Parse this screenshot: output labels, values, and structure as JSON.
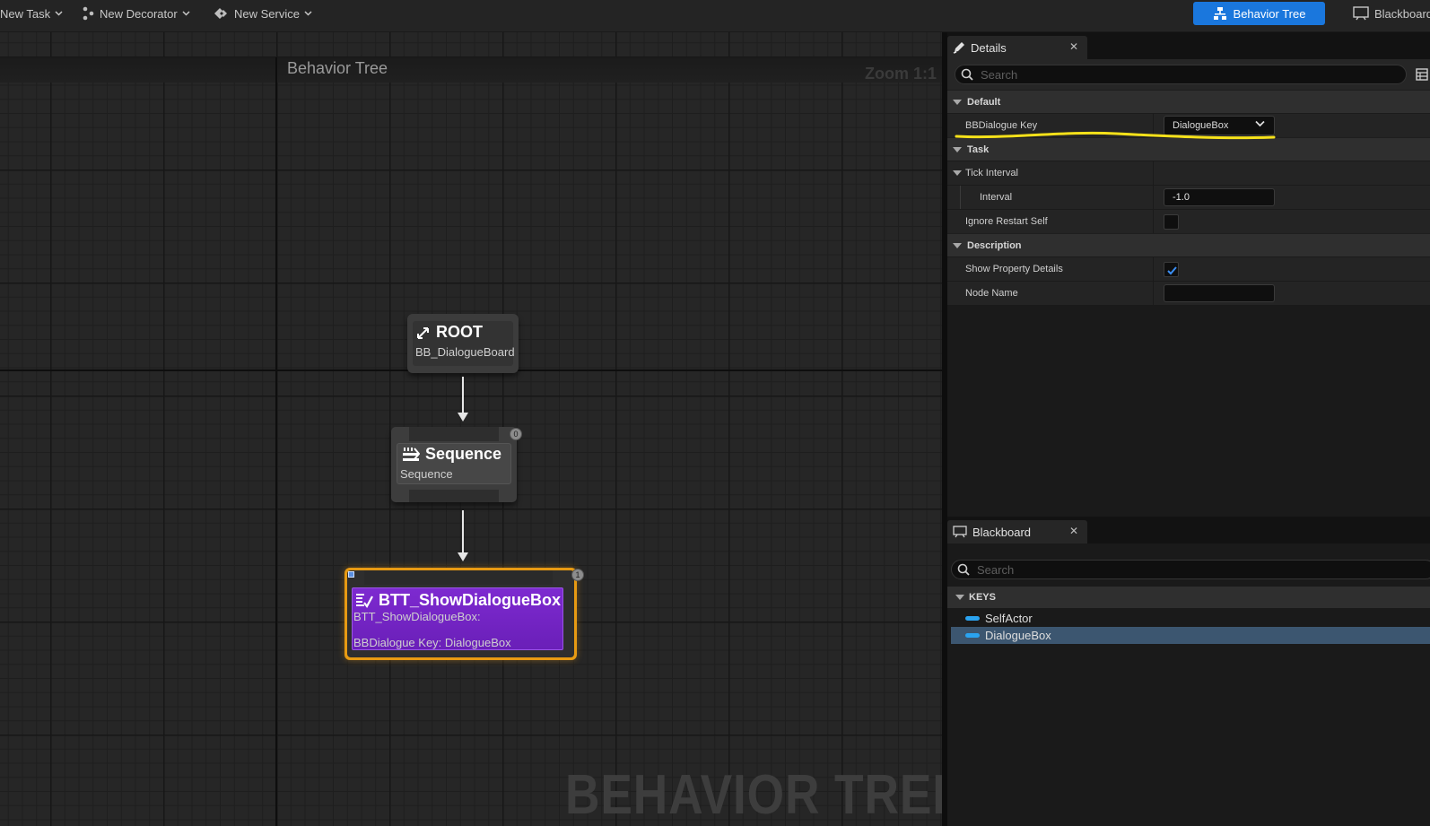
{
  "toolbar": {
    "new_task": "New Task",
    "new_decorator": "New Decorator",
    "new_service": "New Service",
    "mode_behavior_tree": "Behavior Tree",
    "mode_blackboard": "Blackboard"
  },
  "graph": {
    "title": "Behavior Tree",
    "zoom": "Zoom 1:1",
    "watermark": "BEHAVIOR TREE",
    "nodes": {
      "root": {
        "title": "ROOT",
        "subtitle": "BB_DialogueBoard"
      },
      "sequence": {
        "title": "Sequence",
        "subtitle": "Sequence",
        "badge": "0"
      },
      "task": {
        "title": "BTT_ShowDialogueBox",
        "line1": "BTT_ShowDialogueBox:",
        "line2": "BBDialogue Key: DialogueBox",
        "badge": "1"
      }
    }
  },
  "details": {
    "tab_label": "Details",
    "search_placeholder": "Search",
    "categories": {
      "default": "Default",
      "task": "Task",
      "description": "Description"
    },
    "props": {
      "bbdialogue_key": {
        "label": "BBDialogue Key",
        "value": "DialogueBox"
      },
      "tick_interval": {
        "label": "Tick Interval"
      },
      "interval": {
        "label": "Interval",
        "value": "-1.0"
      },
      "ignore_restart_self": {
        "label": "Ignore Restart Self",
        "checked": false
      },
      "show_property_details": {
        "label": "Show Property Details",
        "checked": true
      },
      "node_name": {
        "label": "Node Name",
        "value": ""
      }
    },
    "highlight_color": "#f5e11a"
  },
  "blackboard": {
    "tab_label": "Blackboard",
    "search_placeholder": "Search",
    "keys_label": "KEYS",
    "keys": [
      "SelfActor",
      "DialogueBox"
    ],
    "selected_key": "DialogueBox",
    "key_color": "#2aa3f0"
  },
  "colors": {
    "accent": "#1a77dd",
    "task_node": "#7d2ad0",
    "task_border": "#e79a13"
  }
}
